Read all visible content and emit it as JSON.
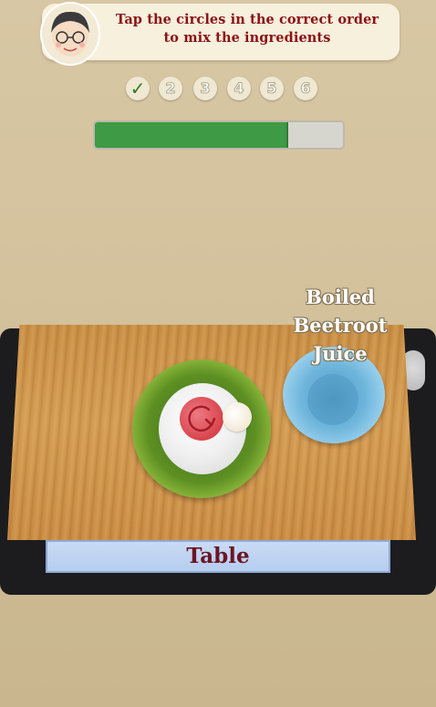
{
  "instruction": {
    "line1": "Tap the circles in the correct order",
    "line2": "to mix the ingredients"
  },
  "steps": [
    {
      "label": "✓",
      "state": "done"
    },
    {
      "label": "2",
      "state": "pending"
    },
    {
      "label": "3",
      "state": "pending"
    },
    {
      "label": "4",
      "state": "pending"
    },
    {
      "label": "5",
      "state": "pending"
    },
    {
      "label": "6",
      "state": "pending"
    }
  ],
  "progress": {
    "value": 0.78,
    "color": "#3e9a44"
  },
  "ingredient": {
    "line1": "Boiled",
    "line2": "Beetroot",
    "line3": "Juice"
  },
  "table_label": "Table",
  "icons": {
    "avatar": "grandma-avatar-icon",
    "mix_direction": "rotate-arrow-icon"
  },
  "colors": {
    "banner_text": "#8c1218",
    "table_text": "#6b1525",
    "mixing_bowl": "#89b63a",
    "ingredient_bowl": "#6fb6dc",
    "beetroot": "#d9444d"
  }
}
